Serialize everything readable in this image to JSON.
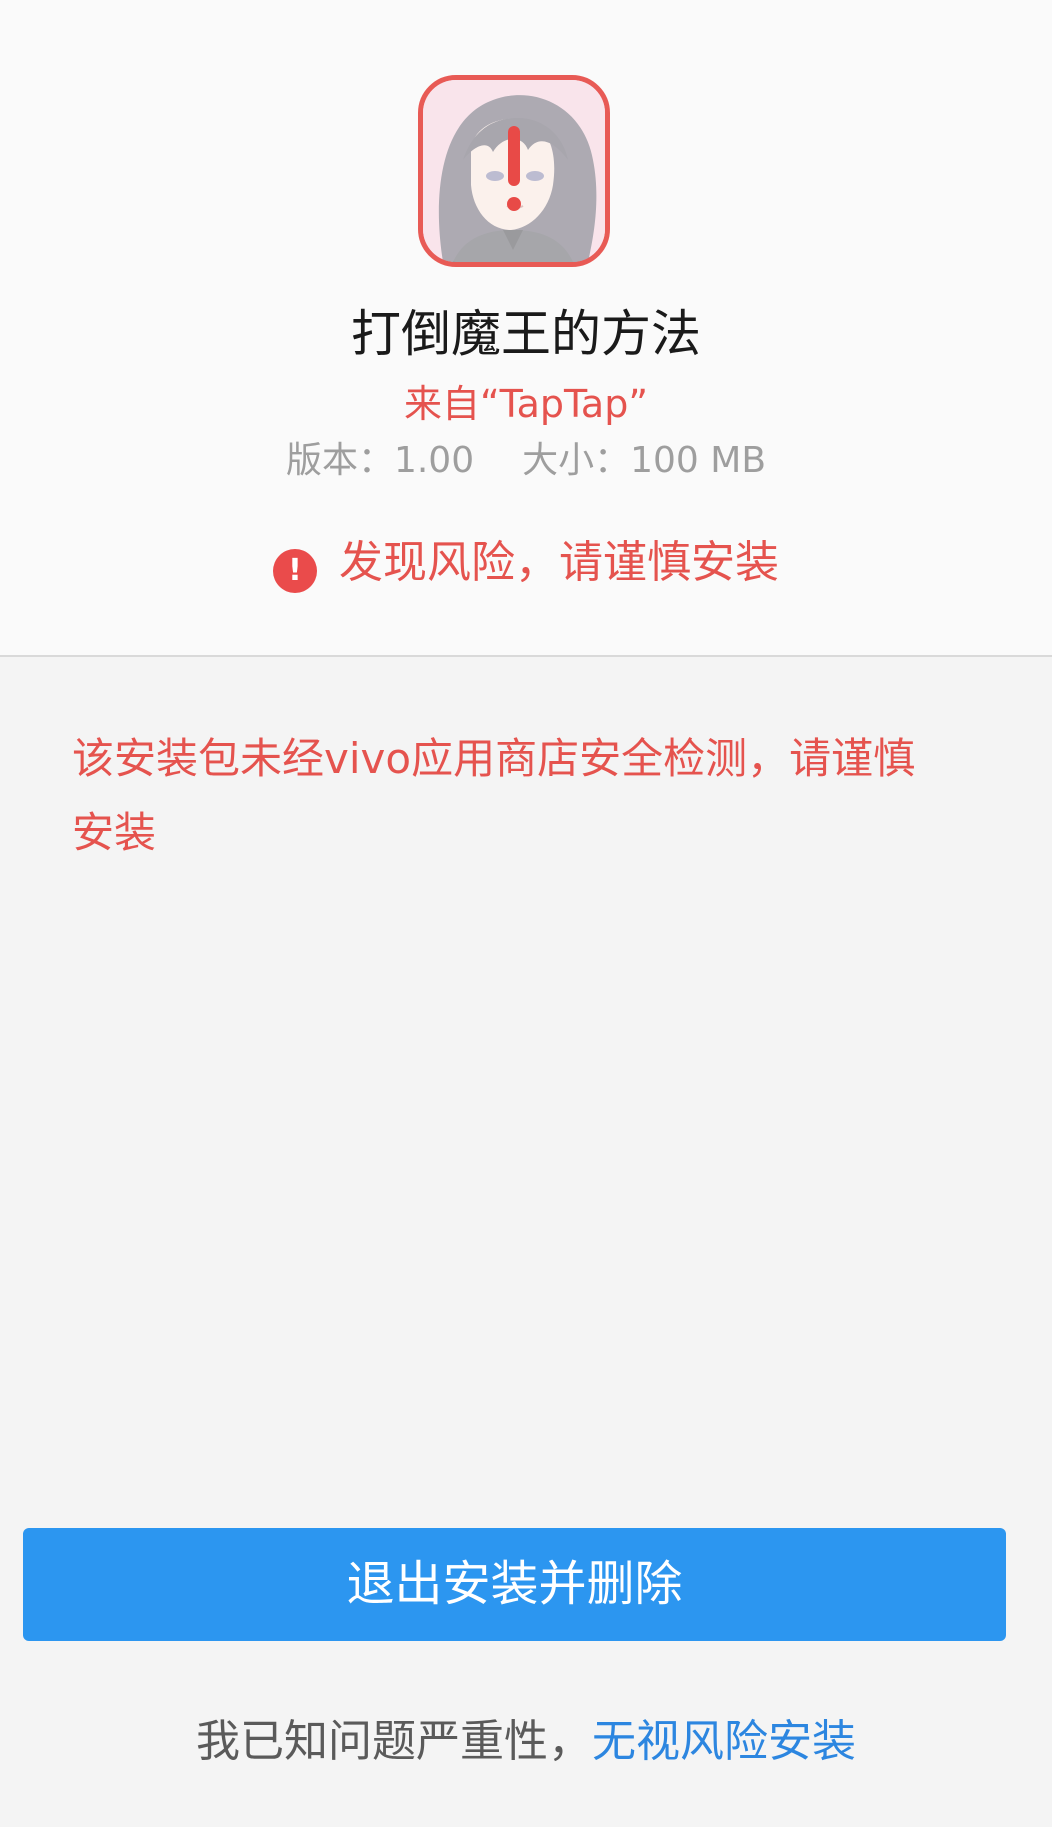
{
  "app": {
    "name": "打倒魔王的方法",
    "source": "来自“TapTap”",
    "version_label": "版本：1.00",
    "size_label": "大小：100 MB",
    "icon": "anime-character-app-icon",
    "alert_icon": "exclamation-icon"
  },
  "risk": {
    "icon": "warning-circle-icon",
    "text": "发现风险，请谨慎安装"
  },
  "warning": {
    "message": "该安装包未经vivo应用商店安全检测，请谨慎安装"
  },
  "actions": {
    "exit_label": "退出安装并删除",
    "acknowledge_text": "我已知问题严重性，",
    "ignore_label": "无视风险安装"
  },
  "colors": {
    "warning_red": "#e5534e",
    "primary_blue": "#2c96f0",
    "link_blue": "#2c86e0"
  }
}
